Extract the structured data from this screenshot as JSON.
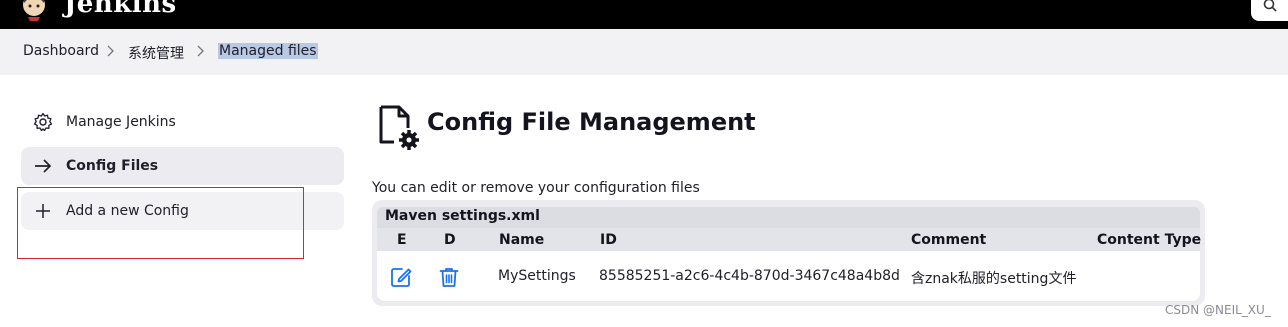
{
  "header": {
    "brand": "Jenkins",
    "logo_icon": "jenkins-butler-icon",
    "search_icon": "search-icon"
  },
  "breadcrumb": {
    "items": [
      "Dashboard",
      "系统管理",
      "Managed files"
    ]
  },
  "sidebar": {
    "items": [
      {
        "label": "Manage Jenkins",
        "icon": "gear-icon",
        "active": false
      },
      {
        "label": "Config Files",
        "icon": "arrow-right-icon",
        "active": true
      },
      {
        "label": "Add a new Config",
        "icon": "plus-icon",
        "active": false
      }
    ]
  },
  "main": {
    "title": "Config File Management",
    "title_icon": "config-file-icon",
    "description": "You can edit or remove your configuration files",
    "table": {
      "group_title": "Maven settings.xml",
      "columns": [
        "E",
        "D",
        "Name",
        "ID",
        "Comment",
        "Content Type"
      ],
      "rows": [
        {
          "edit_icon": "edit-icon",
          "delete_icon": "trash-icon",
          "name": "MySettings",
          "id": "85585251-a2c6-4c4b-870d-3467c48a4b8d",
          "comment": "含znak私服的setting文件",
          "content_type": ""
        }
      ]
    }
  },
  "watermark": "CSDN @NEIL_XU_",
  "colors": {
    "topbar": "#000000",
    "breadcrumb_bg": "#f2f2f5",
    "selection_highlight": "#b7c9e5",
    "action_blue": "#1a73e8",
    "annotation_red": "#d9262c"
  }
}
